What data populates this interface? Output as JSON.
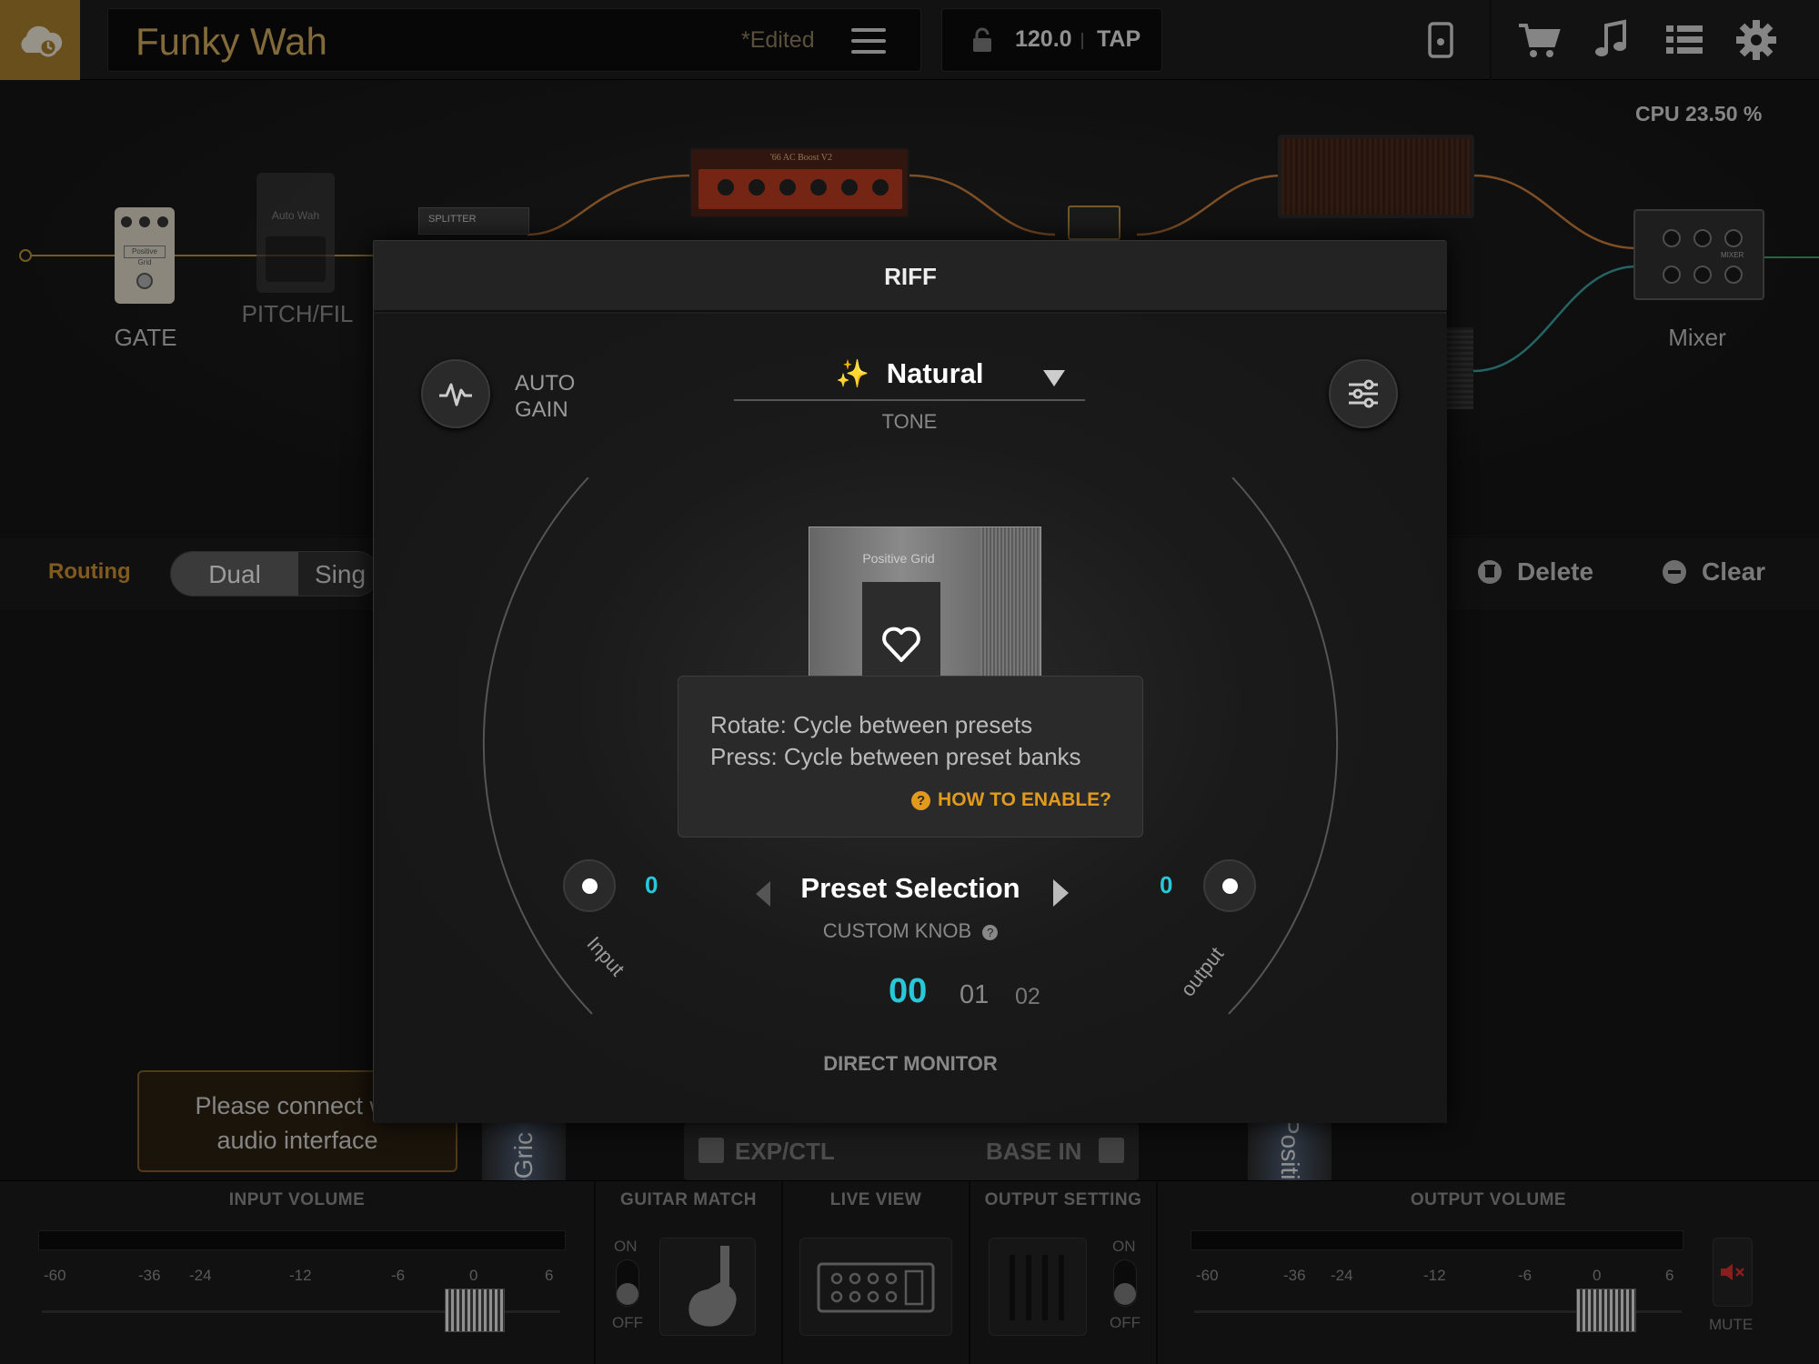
{
  "topbar": {
    "preset_name": "Funky Wah",
    "edited": "*Edited",
    "tempo": "120.0",
    "tap": "TAP",
    "icons": [
      "cloud-icon",
      "menu-icon",
      "lock-icon",
      "device-icon",
      "cart-icon",
      "music-note-icon",
      "list-icon",
      "gear-icon"
    ]
  },
  "cpu": "CPU 23.50 %",
  "chain": {
    "modules": [
      {
        "label": "GATE"
      },
      {
        "label": "PITCH/FIL"
      },
      {
        "label": "Mixer"
      }
    ],
    "amp_name": "'66 AC Boost V2",
    "splitter_label": "SPLITTER",
    "gate_pedal_brand": "Positive Grid",
    "pitch_pedal_name": "Auto Wah",
    "mixer_text": "MIXER"
  },
  "routing": {
    "label": "Routing",
    "options": [
      "Dual",
      "Sing"
    ],
    "delete": "Delete",
    "clear": "Clear"
  },
  "notice": {
    "line1": "Please connect wit",
    "line2": "audio interface"
  },
  "pedal_strip": {
    "exp": "EXP/CTL",
    "base": "BASE IN",
    "left_brand": "veGric",
    "right_brand": "Positi"
  },
  "bottom": {
    "input_volume": "INPUT VOLUME",
    "guitar_match": "GUITAR MATCH",
    "live_view": "LIVE VIEW",
    "output_setting": "OUTPUT SETTING",
    "output_volume": "OUTPUT VOLUME",
    "ticks": [
      "-60",
      "-36",
      "-24",
      "-12",
      "-6",
      "0",
      "6"
    ],
    "on": "ON",
    "off": "OFF",
    "mute": "MUTE"
  },
  "modal": {
    "title": "RIFF",
    "auto_gain": "AUTO",
    "auto_gain2": "GAIN",
    "tone_name": "Natural",
    "tone_label": "TONE",
    "device_brand": "Positive Grid",
    "tooltip_line1": "Rotate: Cycle between presets",
    "tooltip_line2": "Press: Cycle between preset banks",
    "how_to": "HOW TO ENABLE?",
    "input_value": "0",
    "output_value": "0",
    "input_label": "Input",
    "output_label": "output",
    "preset_selection": "Preset Selection",
    "custom_knob": "CUSTOM KNOB",
    "dm_values": [
      "00",
      "01",
      "02"
    ],
    "direct_monitor": "DIRECT MONITOR",
    "accent": "#27c8d8",
    "warning": "#e29a1c"
  }
}
